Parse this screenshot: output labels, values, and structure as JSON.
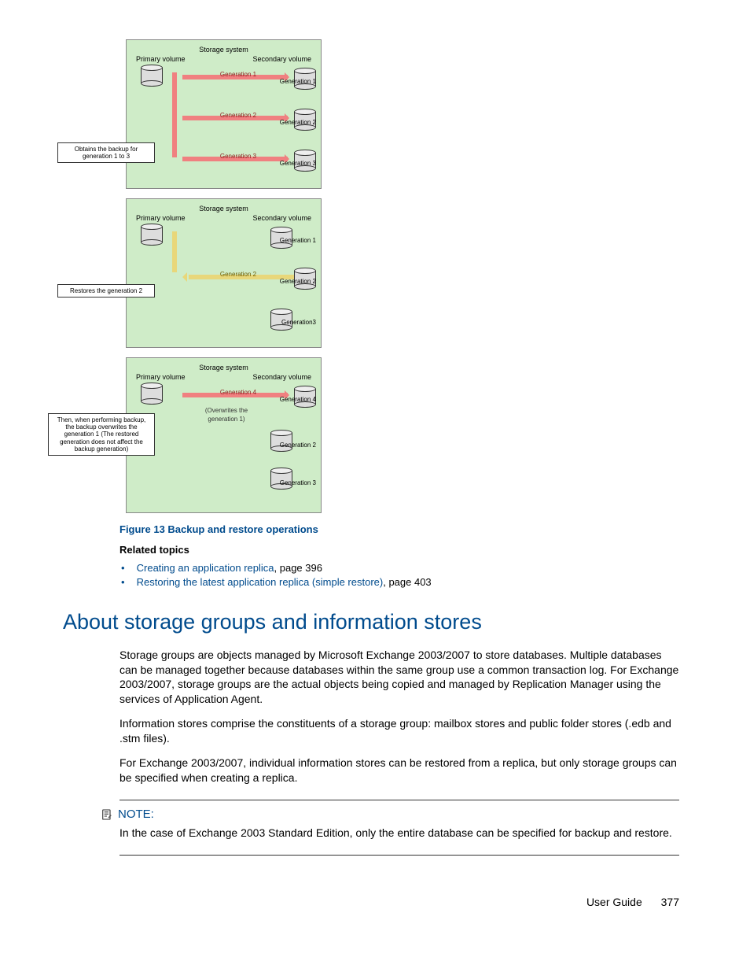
{
  "diagrams": {
    "storage_system": "Storage system",
    "primary": "Primary volume",
    "secondary": "Secondary volume",
    "d1": {
      "arrows": [
        "Generation 1",
        "Generation 2",
        "Generation 3"
      ],
      "right_labels": [
        "Generation 1",
        "Generation 2",
        "Generation 3"
      ],
      "callout": "Obtains the backup for generation 1 to 3"
    },
    "d2": {
      "arrow": "Generation 2",
      "right_labels": [
        "Generation 1",
        "Generation 2",
        "Generation3"
      ],
      "callout": "Restores the generation 2"
    },
    "d3": {
      "arrow": "Generation 4",
      "arrow_sub1": "(Overwrites the",
      "arrow_sub2": "generation 1)",
      "right_labels": [
        "Generation 4",
        "Generation 2",
        "Generation 3"
      ],
      "callout": "Then, when performing backup, the backup overwrites the generation 1 (The restored generation does not affect the backup generation)"
    }
  },
  "figure_caption": "Figure 13 Backup and restore operations",
  "related_topics_heading": "Related topics",
  "links": [
    {
      "text": "Creating an application replica",
      "suffix": ", page 396"
    },
    {
      "text": "Restoring the latest application replica (simple restore)",
      "suffix": ", page 403"
    }
  ],
  "section_heading": "About storage groups and information stores",
  "paragraphs": [
    "Storage groups are objects managed by Microsoft Exchange 2003/2007 to store databases. Multiple databases can be managed together because databases within the same group use a common transaction log. For Exchange 2003/2007, storage groups are the actual objects being copied and managed by Replication Manager using the services of Application Agent.",
    "Information stores comprise the constituents of a storage group: mailbox stores and public folder stores (.edb and .stm files).",
    "For Exchange 2003/2007, individual information stores can be restored from a replica, but only storage groups can be specified when creating a replica."
  ],
  "note_label": "NOTE:",
  "note_text": "In the case of Exchange 2003 Standard Edition, only the entire database can be specified for backup and restore.",
  "footer_label": "User Guide",
  "footer_page": "377"
}
